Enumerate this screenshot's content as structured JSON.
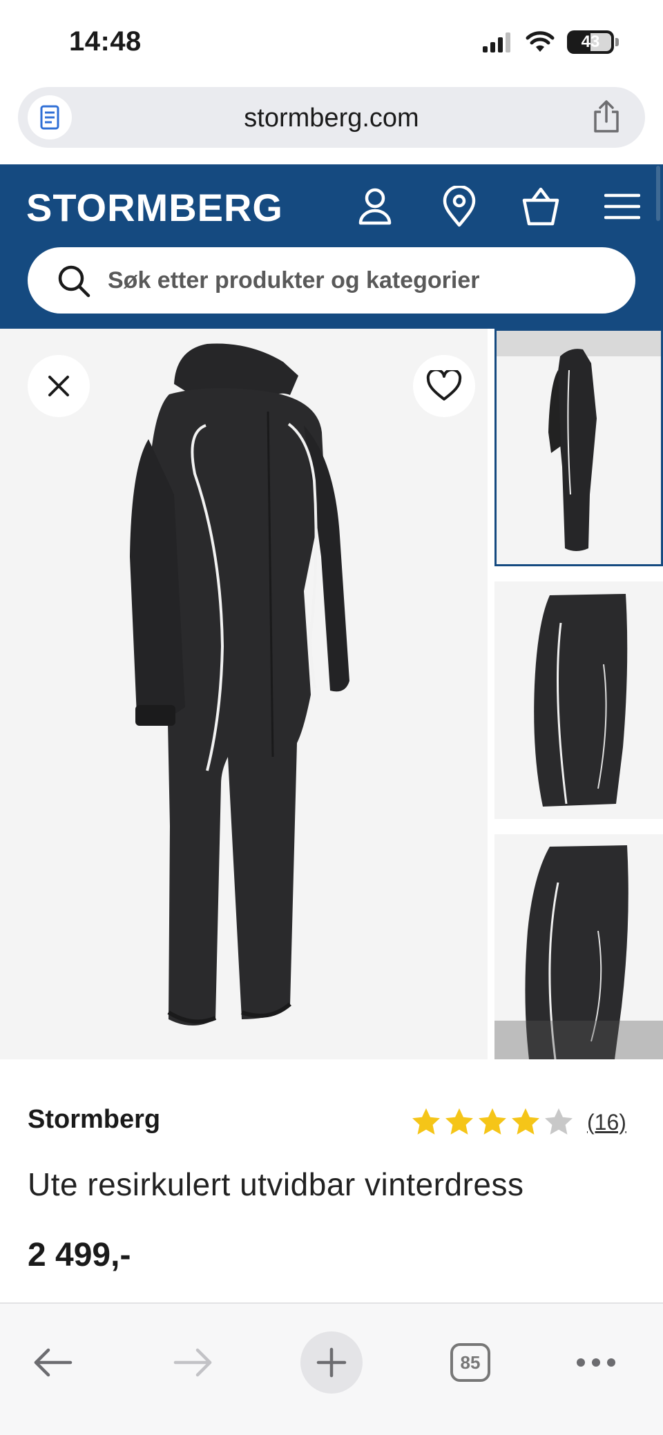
{
  "status_bar": {
    "time": "14:48",
    "battery": "43"
  },
  "browser": {
    "url": "stormberg.com"
  },
  "header": {
    "logo_text": "STORMBERG",
    "search_placeholder": "Søk etter produkter og kategorier",
    "icons": [
      "user-icon",
      "location-pin-icon",
      "shopping-bag-icon",
      "menu-icon"
    ]
  },
  "product": {
    "brand": "Stormberg",
    "name": "Ute resirkulert utvidbar vinterdress",
    "price": "2 499,-",
    "rating": 4,
    "rating_max": 5,
    "review_count": "(16)"
  },
  "gallery": {
    "thumbnails": 3,
    "active_thumbnail": 1
  },
  "toolbar": {
    "tab_count": "85"
  },
  "colors": {
    "brand_blue": "#154a80",
    "star_gold": "#f5c518",
    "star_empty": "#c8c8c8",
    "suit": "#2a2a2c"
  }
}
